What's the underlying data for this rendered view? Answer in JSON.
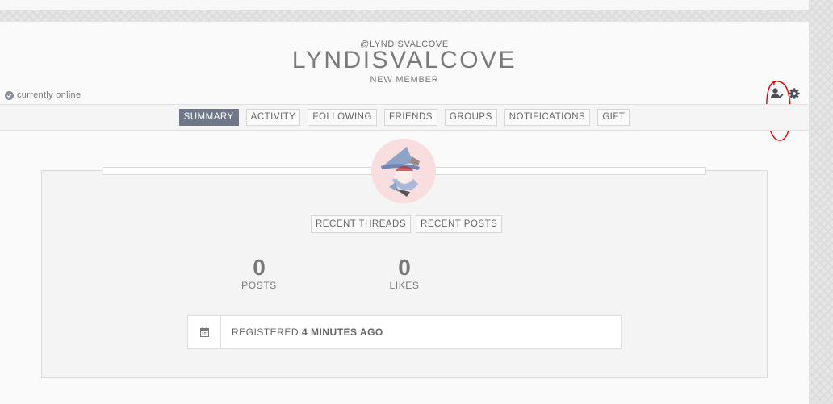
{
  "profile": {
    "handle": "@LYNDISVALCOVE",
    "username": "LYNDISVALCOVE",
    "role": "NEW MEMBER",
    "status": "currently online"
  },
  "tabs": [
    {
      "label": "SUMMARY",
      "active": true
    },
    {
      "label": "ACTIVITY"
    },
    {
      "label": "FOLLOWING"
    },
    {
      "label": "FRIENDS"
    },
    {
      "label": "GROUPS"
    },
    {
      "label": "NOTIFICATIONS"
    },
    {
      "label": "GIFT"
    }
  ],
  "recent": {
    "threads_label": "RECENT THREADS",
    "posts_label": "RECENT POSTS"
  },
  "stats": {
    "posts": {
      "value": "0",
      "label": "POSTS"
    },
    "likes": {
      "value": "0",
      "label": "LIKES"
    }
  },
  "registered": {
    "prefix": "REGISTERED",
    "value": "4 MINUTES AGO"
  },
  "icons": {
    "edit": "user-edit-icon",
    "settings": "gear-icon",
    "calendar": "calendar-icon",
    "online": "check-circle-icon"
  },
  "colors": {
    "active_tab": "#6f7888",
    "annotation": "#e00000"
  }
}
